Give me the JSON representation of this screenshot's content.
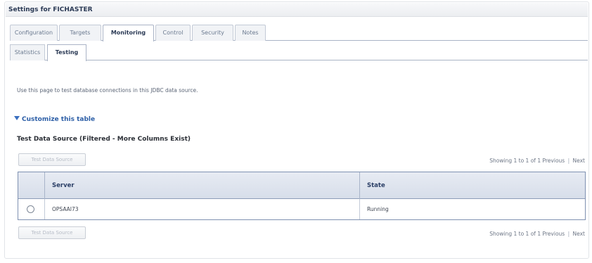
{
  "window": {
    "title": "Settings for FICHASTER"
  },
  "tabs": [
    {
      "label": "Configuration",
      "active": false
    },
    {
      "label": "Targets",
      "active": false
    },
    {
      "label": "Monitoring",
      "active": true
    },
    {
      "label": "Control",
      "active": false
    },
    {
      "label": "Security",
      "active": false
    },
    {
      "label": "Notes",
      "active": false
    }
  ],
  "subtabs": [
    {
      "label": "Statistics",
      "active": false
    },
    {
      "label": "Testing",
      "active": true
    }
  ],
  "intro_text": "Use this page to test database connections in this JDBC data source.",
  "customize_link": "Customize this table",
  "section_title": "Test Data Source (Filtered - More Columns Exist)",
  "toolbar": {
    "test_button_label": "Test Data Source"
  },
  "pager": {
    "text": "Showing 1 to 1 of 1",
    "previous": "Previous",
    "separator": "|",
    "next": "Next"
  },
  "table": {
    "headers": {
      "server": "Server",
      "state": "State"
    },
    "rows": [
      {
        "server": "OPSAAI73",
        "state": "Running",
        "selected": false
      }
    ]
  }
}
